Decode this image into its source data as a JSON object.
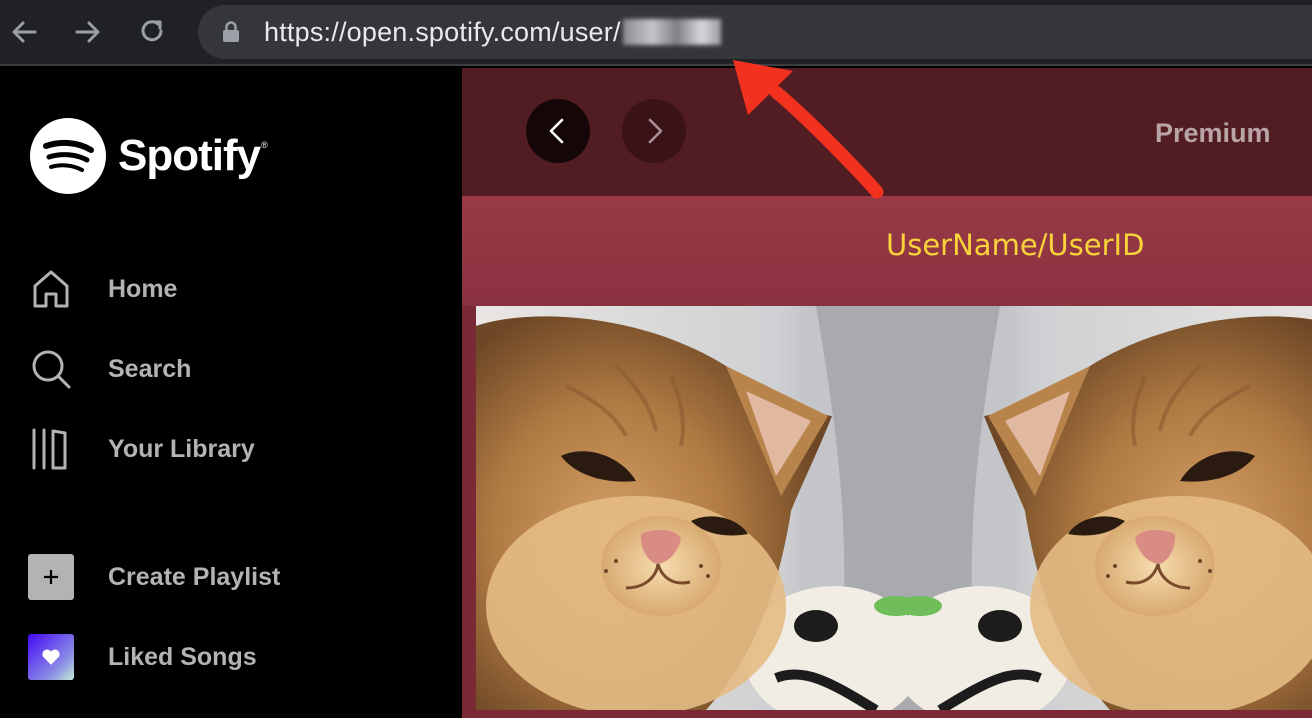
{
  "browser": {
    "url": "https://open.spotify.com/user/",
    "back_icon": "arrow-left-icon",
    "forward_icon": "arrow-right-icon",
    "reload_icon": "reload-icon",
    "lock_icon": "lock-icon"
  },
  "sidebar": {
    "brand": "Spotify",
    "items": [
      {
        "label": "Home",
        "icon": "home-icon"
      },
      {
        "label": "Search",
        "icon": "search-icon"
      },
      {
        "label": "Your Library",
        "icon": "library-icon"
      },
      {
        "label": "Create Playlist",
        "icon": "plus-icon"
      },
      {
        "label": "Liked Songs",
        "icon": "heart-icon"
      }
    ]
  },
  "main": {
    "premium_label": "Premium",
    "annotation": "UserName/UserID",
    "profile_images": [
      "cat-photo",
      "cat-photo-mirrored"
    ]
  },
  "colors": {
    "annotation": "#f8d33a",
    "arrow": "#f2321e",
    "main_bg": "#7a2a34",
    "topbar_bg": "#521c23"
  }
}
